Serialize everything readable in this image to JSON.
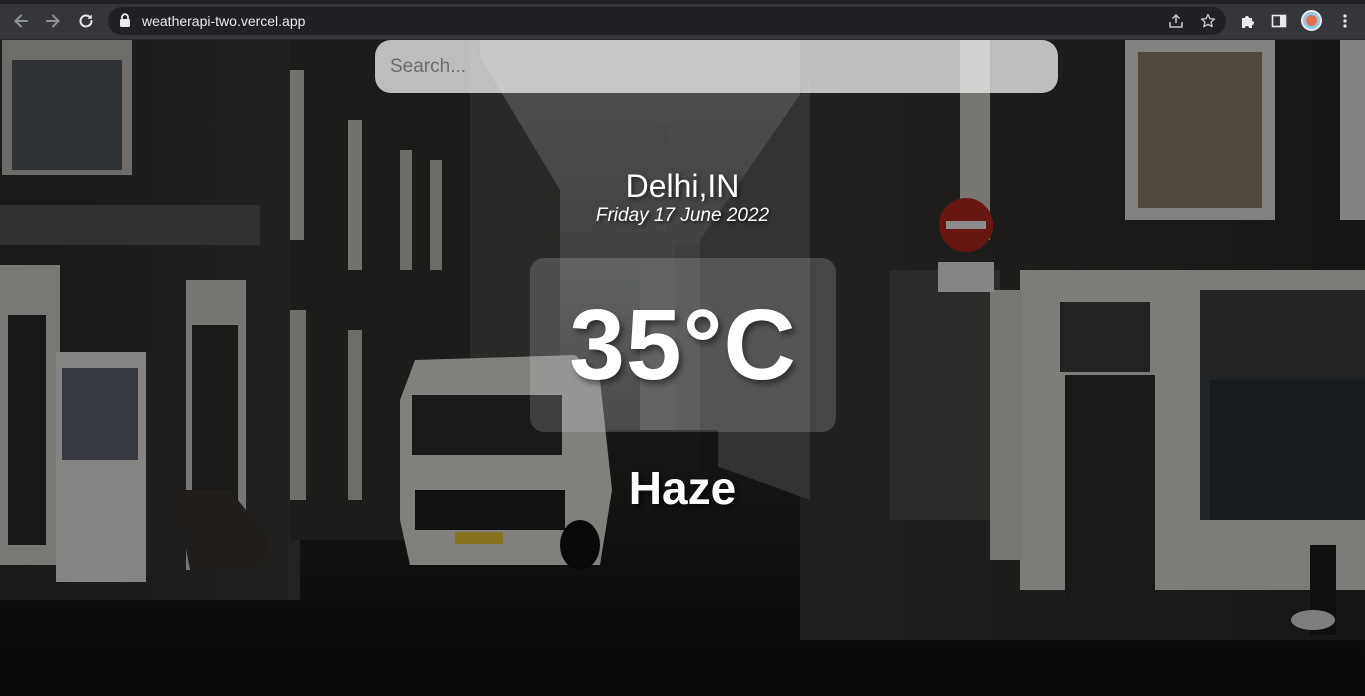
{
  "browser": {
    "url": "weatherapi-two.vercel.app",
    "icons": {
      "back": "back-arrow-icon",
      "forward": "forward-arrow-icon",
      "reload": "reload-icon",
      "lock": "lock-icon",
      "share": "share-icon",
      "bookmark": "star-icon",
      "extensions": "puzzle-icon",
      "sidepanel": "side-panel-icon",
      "menu": "kebab-menu-icon"
    }
  },
  "search": {
    "placeholder": "Search...",
    "value": ""
  },
  "weather": {
    "location": "Delhi,IN",
    "date": "Friday 17 June 2022",
    "temperature": "35°C",
    "condition": "Haze"
  },
  "colors": {
    "text": "#ffffff",
    "search_bg": "#ebebeb",
    "chrome_bg": "#35363a"
  }
}
